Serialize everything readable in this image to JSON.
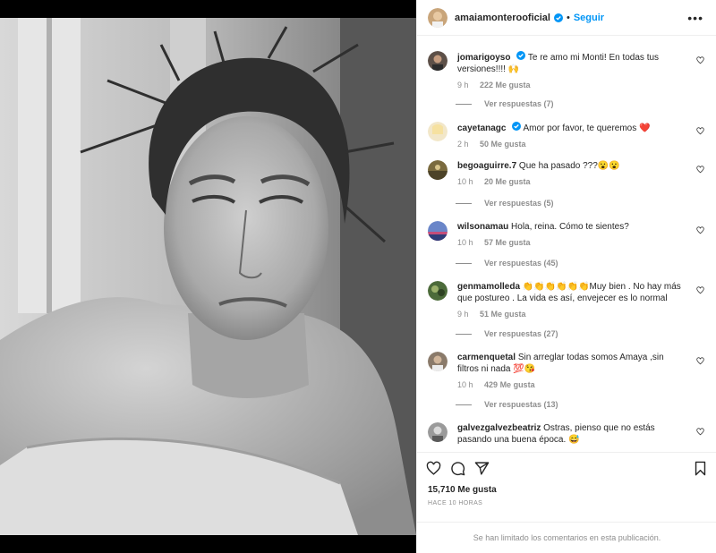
{
  "post": {
    "owner": "amaiamonterooficial",
    "separator": "•",
    "follow_label": "Seguir",
    "more_label": "•••",
    "likes": "15,710 Me gusta",
    "timestamp": "HACE 10 HORAS",
    "limited_notice": "Se han limitado los comentarios en esta publicación.",
    "photo_icon": "grayscale-selfie-photo"
  },
  "colors": {
    "accent": "#0095f6",
    "verified": "#0095f6",
    "muted": "#8e8e8e",
    "text": "#262626"
  },
  "comments": [
    {
      "user": "jomarigoyso",
      "verified": true,
      "text": "Te re amo mi Monti! En todas tus versiones!!!! 🙌",
      "time": "9 h",
      "likes": "222 Me gusta",
      "replies": "Ver respuestas (7)"
    },
    {
      "user": "cayetanagc",
      "verified": true,
      "text": "Amor por favor, te queremos ❤️",
      "time": "2 h",
      "likes": "50 Me gusta",
      "replies": ""
    },
    {
      "user": "begoaguirre.7",
      "verified": false,
      "text": "Que ha pasado ???😮😮",
      "time": "10 h",
      "likes": "20 Me gusta",
      "replies": "Ver respuestas (5)"
    },
    {
      "user": "wilsonamau",
      "verified": false,
      "text": "Hola, reina. Cómo te sientes?",
      "time": "10 h",
      "likes": "57 Me gusta",
      "replies": "Ver respuestas (45)"
    },
    {
      "user": "genmamolleda",
      "verified": false,
      "text": "👏👏👏👏👏👏Muy bien . No hay más que postureo . La vida es así, envejecer es lo normal",
      "time": "9 h",
      "likes": "51 Me gusta",
      "replies": "Ver respuestas (27)"
    },
    {
      "user": "carmenquetal",
      "verified": false,
      "text": "Sin arreglar todas somos Amaya ,sin filtros ni nada 💯😘",
      "time": "10 h",
      "likes": "429 Me gusta",
      "replies": "Ver respuestas (13)"
    },
    {
      "user": "galvezgalvezbeatriz",
      "verified": false,
      "text": "Ostras, pienso que no estás pasando una buena época. 😅",
      "time": "",
      "likes": "",
      "replies": ""
    }
  ],
  "icons": {
    "like": "heart-icon",
    "comment": "comment-icon",
    "share": "share-icon",
    "save": "bookmark-icon",
    "verified": "verified-badge-icon",
    "more": "more-options-icon"
  }
}
